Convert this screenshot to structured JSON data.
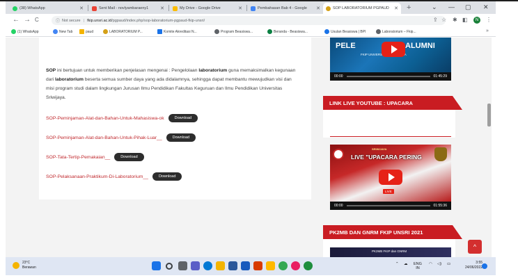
{
  "browser": {
    "tabs": [
      {
        "label": "(38) WhatsApp",
        "icon": "whatsapp-icon",
        "color": "#25d366",
        "active": false
      },
      {
        "label": "Sent Mail - novlyambaraeny1",
        "icon": "gmail-icon",
        "color": "#ea4335",
        "active": false
      },
      {
        "label": "My Drive - Google Drive",
        "icon": "drive-icon",
        "color": "#fbbc04",
        "active": false
      },
      {
        "label": "Pembahasan Bab 4 - Google",
        "icon": "docs-icon",
        "color": "#4285f4",
        "active": false
      },
      {
        "label": "SOP LABORATORIUM PGPAUD",
        "icon": "site-icon",
        "color": "#d4a017",
        "active": true
      }
    ],
    "new_tab": "+",
    "window_controls": {
      "minimize": "—",
      "maximize": "▢",
      "close": "✕",
      "tab_search": "⌄"
    }
  },
  "toolbar": {
    "back": "←",
    "forward": "→",
    "reload": "C",
    "security_label": "Not secure",
    "url_host": "fkip.unsri.ac.id",
    "url_path": "/pgpaud/index.php/sop-laboratorium-pgpaud-fkip-unsri/",
    "profile_initial": "N"
  },
  "bookmarks": [
    {
      "label": "(1) WhatsApp",
      "color": "#25d366"
    },
    {
      "label": "New Tab",
      "color": "#4285f4"
    },
    {
      "label": "paud",
      "color": "#f4b400"
    },
    {
      "label": "LABORATORIUM P...",
      "color": "#d4a017"
    },
    {
      "label": "Komite Akreditasi N...",
      "color": "#1a73e8"
    },
    {
      "label": "Program Beasiswa...",
      "color": "#5f6368"
    },
    {
      "label": "Beranda - Beasiswa...",
      "color": "#0b8043"
    },
    {
      "label": "Usulan Beasiswa | BPI",
      "color": "#1a73e8"
    },
    {
      "label": "Laboratorium – Fkip...",
      "color": "#5f6368"
    }
  ],
  "main": {
    "intro_bold_1": "SOP",
    "intro_text_1": " ini bertujuan untuk memberikan penjelasan mengenai : Pengelolaan ",
    "intro_bold_2": "laboratorium",
    "intro_text_2": " guna memaksimalkan kegunaan dari ",
    "intro_bold_3": "laboratorium",
    "intro_text_3": " beserta semua sumber daya yang ada didalamnya, sehingga dapat membantu mewujudkan visi dan misi program studi dalam lingkungan Jurusan Ilmu Pendidikan Fakultas Keguruan dan Ilmu Pendidikan Universitas Sriwijaya.",
    "sop_items": [
      {
        "label": "SOP-Peminjaman-Alat-dan-Bahan-Untuk-Mahasiswa-ok",
        "button": "Download"
      },
      {
        "label": "SOP-Peminjaman-Alat-dan-Bahan-Untuk-Pihak-Luar__",
        "button": "Download"
      },
      {
        "label": "SOP-Tata-Tertip-Pemakaian__",
        "button": "Download"
      },
      {
        "label": "SOP-Pelaksanaan-Praktikum-Di-Laboratorium__",
        "button": "Download"
      }
    ]
  },
  "sidebar": {
    "video1": {
      "overlay_text": "PELE",
      "overlay_text_2": "ALUMNI",
      "subtitle": "FKIP UNIVERSITAS SRIWIJAYA",
      "time_current": "00:00",
      "time_total": "01:45:29"
    },
    "widget1_title": "LINK LIVE YOUTUBE : UPACARA",
    "video2": {
      "overlay_text": "LIVE \"UPACARA PERING",
      "header_text": "SRIWIJAYA",
      "live_badge": "LIVE",
      "time_current": "00:00",
      "time_total": "01:55:36"
    },
    "widget2_title": "PK2MB DAN GNRM FKIP UNSRI 2021",
    "video3": {
      "caption": "PK2MB FKIP dan GNRM"
    }
  },
  "scroll_top": "^",
  "taskbar": {
    "weather_temp": "23°C",
    "weather_desc": "Berawan",
    "language": "ENG",
    "language_sub": "IN",
    "time": "3:55",
    "date": "24/06/2022"
  }
}
